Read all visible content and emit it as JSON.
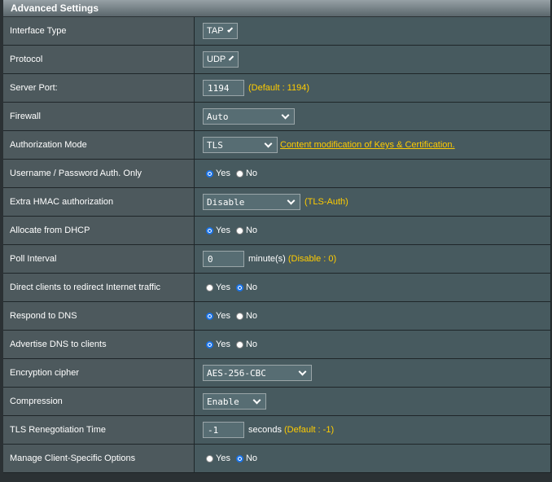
{
  "header": {
    "title": "Advanced Settings"
  },
  "rows": {
    "interface_type": {
      "label": "Interface Type",
      "value": "TAP"
    },
    "protocol": {
      "label": "Protocol",
      "value": "UDP"
    },
    "server_port": {
      "label": "Server Port:",
      "value": "1194",
      "hint": "(Default : 1194)"
    },
    "firewall": {
      "label": "Firewall",
      "value": "Auto"
    },
    "auth_mode": {
      "label": "Authorization Mode",
      "value": "TLS",
      "link": "Content modification of Keys & Certification."
    },
    "user_pass_auth": {
      "label": "Username / Password Auth. Only",
      "yes": "Yes",
      "no": "No",
      "selected": "yes"
    },
    "extra_hmac": {
      "label": "Extra HMAC authorization",
      "value": "Disable",
      "hint": "(TLS-Auth)"
    },
    "allocate_dhcp": {
      "label": "Allocate from DHCP",
      "yes": "Yes",
      "no": "No",
      "selected": "yes"
    },
    "poll_interval": {
      "label": "Poll Interval",
      "value": "0",
      "unit": "minute(s)",
      "hint": "(Disable : 0)"
    },
    "redirect_traffic": {
      "label": "Direct clients to redirect Internet traffic",
      "yes": "Yes",
      "no": "No",
      "selected": "no"
    },
    "respond_dns": {
      "label": "Respond to DNS",
      "yes": "Yes",
      "no": "No",
      "selected": "yes"
    },
    "advertise_dns": {
      "label": "Advertise DNS to clients",
      "yes": "Yes",
      "no": "No",
      "selected": "yes"
    },
    "encryption_cipher": {
      "label": "Encryption cipher",
      "value": "AES-256-CBC"
    },
    "compression": {
      "label": "Compression",
      "value": "Enable"
    },
    "tls_renegotiation": {
      "label": "TLS Renegotiation Time",
      "value": "-1",
      "unit": "seconds",
      "hint": "(Default : -1)"
    },
    "client_specific": {
      "label": "Manage Client-Specific Options",
      "yes": "Yes",
      "no": "No",
      "selected": "no"
    }
  }
}
